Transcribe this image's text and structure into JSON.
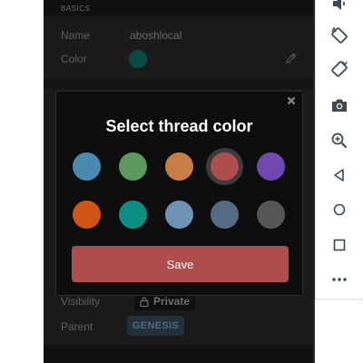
{
  "settings": {
    "section_header": "BASICS",
    "name_label": "Name",
    "name_value": "aboshlocal",
    "color_label": "Color",
    "visibility_label": "Visibility",
    "visibility_value": "Private",
    "parent_label": "Parent",
    "parent_value": "GENESIS"
  },
  "modal": {
    "title": "Select thread color",
    "save_label": "Save",
    "selected_index": 3,
    "swatches": [
      {
        "color": "#4a8ab0"
      },
      {
        "color": "#5a9a5c"
      },
      {
        "color": "#c77d44"
      },
      {
        "color": "#b04e4f"
      },
      {
        "color": "#7049b0"
      },
      {
        "color": "#cf5515"
      },
      {
        "color": "#0e8f85"
      },
      {
        "color": "#6d93b5"
      },
      {
        "color": "#566b85"
      },
      {
        "color": "#565656"
      }
    ]
  },
  "emulator_toolbar": {
    "buttons": [
      {
        "icon": "volume-down-icon"
      },
      {
        "icon": "rotate-left-icon"
      },
      {
        "icon": "rotate-right-icon"
      },
      {
        "icon": "camera-icon"
      },
      {
        "icon": "zoom-in-icon"
      },
      {
        "icon": "back-icon"
      },
      {
        "icon": "home-icon"
      },
      {
        "icon": "overview-icon"
      },
      {
        "icon": "more-icon"
      }
    ]
  }
}
